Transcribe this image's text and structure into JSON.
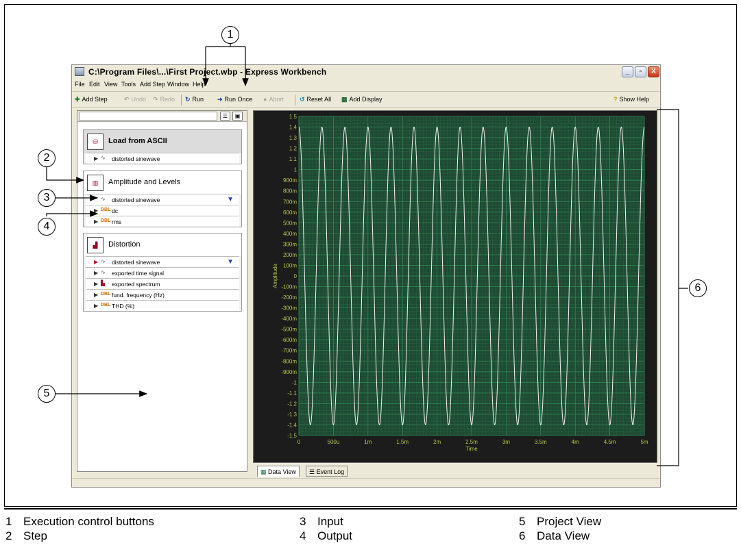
{
  "window": {
    "title": "C:\\Program Files\\...\\First Project.wbp - Express Workbench",
    "min_glyph": "_",
    "max_glyph": "▫",
    "close_glyph": "X"
  },
  "menu": [
    "File",
    "Edit",
    "View",
    "Tools",
    "Add Step",
    "Window",
    "Help"
  ],
  "toolbar": {
    "add_step": "Add Step",
    "undo": "Undo",
    "redo": "Redo",
    "run": "Run",
    "run_once": "Run Once",
    "abort": "Abort",
    "reset_all": "Reset All",
    "add_display": "Add Display",
    "show_help": "Show Help"
  },
  "project": {
    "steps": [
      {
        "title": "Load from ASCII",
        "rows": [
          {
            "label": "distorted sinewave",
            "kind": "signal"
          }
        ]
      },
      {
        "title": "Amplitude and Levels",
        "rows": [
          {
            "label": "distorted sinewave",
            "kind": "signal"
          },
          {
            "label": "dc",
            "kind": "dbl"
          },
          {
            "label": "rms",
            "kind": "dbl"
          }
        ]
      },
      {
        "title": "Distortion",
        "rows": [
          {
            "label": "distorted sinewave",
            "kind": "signal"
          },
          {
            "label": "exported time signal",
            "kind": "signal"
          },
          {
            "label": "exported spectrum",
            "kind": "spectrum"
          },
          {
            "label": "fund. frequency (Hz)",
            "kind": "dbl"
          },
          {
            "label": "THD (%)",
            "kind": "dbl"
          }
        ]
      }
    ],
    "dbl_tag": "DBL"
  },
  "tabs": {
    "data_view": "Data View",
    "event_log": "Event Log"
  },
  "callouts": [
    "1",
    "2",
    "3",
    "4",
    "5",
    "6"
  ],
  "legend": [
    {
      "n": "1",
      "label": "Execution control buttons"
    },
    {
      "n": "2",
      "label": "Step"
    },
    {
      "n": "3",
      "label": "Input"
    },
    {
      "n": "4",
      "label": "Output"
    },
    {
      "n": "5",
      "label": "Project View"
    },
    {
      "n": "6",
      "label": "Data View"
    }
  ],
  "colors": {
    "plot_bg": "#1f4a33",
    "grid": "#2e8b57",
    "axis_text": "#b8c84a",
    "trace": "#f2f2f2"
  },
  "chart_data": {
    "type": "line",
    "xlabel": "Time",
    "ylabel": "Amplitude",
    "x_ticks": [
      "0",
      "500u",
      "1m",
      "1.5m",
      "2m",
      "2.5m",
      "3m",
      "3.5m",
      "4m",
      "4.5m",
      "5m"
    ],
    "y_ticks": [
      "1.5",
      "1.4",
      "1.3",
      "1.2",
      "1.1",
      "1",
      "900m",
      "800m",
      "700m",
      "600m",
      "500m",
      "400m",
      "300m",
      "200m",
      "100m",
      "0",
      "-100m",
      "-200m",
      "-300m",
      "-400m",
      "-500m",
      "-600m",
      "-700m",
      "-800m",
      "-900m",
      "-1",
      "-1.1",
      "-1.2",
      "-1.3",
      "-1.4",
      "-1.5"
    ],
    "xlim": [
      0,
      0.005
    ],
    "ylim": [
      -1.5,
      1.5
    ],
    "signal": {
      "shape": "sine",
      "amplitude": 1.4,
      "frequency_hz": 3000,
      "phase_deg": 90
    },
    "grid": true
  }
}
